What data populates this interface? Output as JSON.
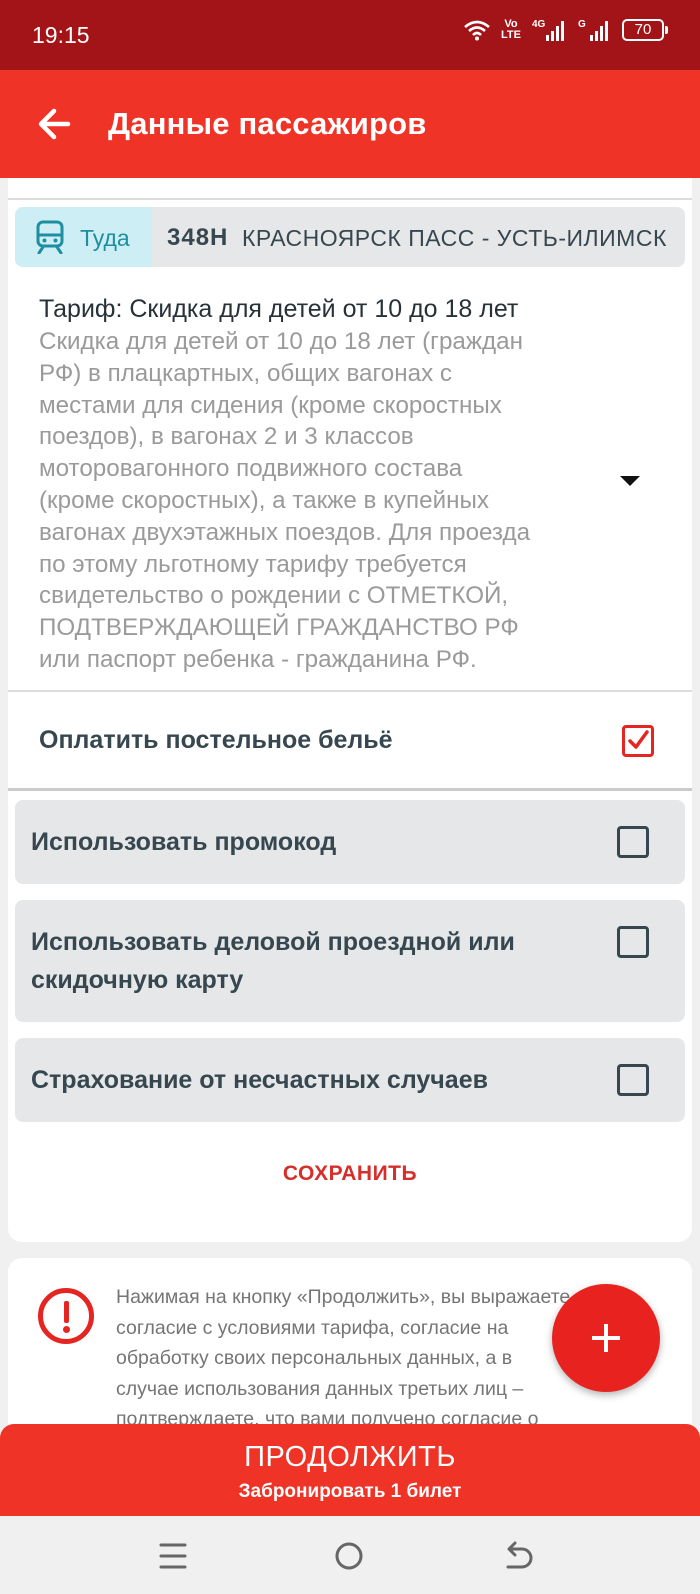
{
  "status_bar": {
    "time": "19:15",
    "volte": "Vo LTE",
    "net1": "4G",
    "net2": "G",
    "battery": "70"
  },
  "app_bar": {
    "title": "Данные пассажиров",
    "back_icon": "arrow-left-icon"
  },
  "route": {
    "direction": "Туда",
    "train_number": "348Н",
    "route_name": "КРАСНОЯРСК ПАСС - УСТЬ-ИЛИМСК",
    "icon": "train-icon",
    "accent_color": "#1d8fa0"
  },
  "tariff": {
    "title": "Тариф: Скидка для детей от 10 до 18 лет",
    "lines": [
      "Скидка для детей от 10 до 18 лет (граждан",
      "РФ) в плацкартных, общих вагонах с",
      "местами для сидения (кроме скоростных",
      "поездов), в вагонах 2 и 3 классов",
      "моторовагонного подвижного состава",
      "(кроме скоростных), а также в купейных",
      "вагонах двухэтажных поездов. Для проезда",
      "по этому льготному тарифу требуется",
      "свидетельство о рождении с ОТМЕТКОЙ,",
      "ПОДТВЕРЖДАЮЩЕЙ ГРАЖДАНСТВО РФ",
      "или паспорт ребенка - гражданина РФ."
    ]
  },
  "options": {
    "bed_linen": {
      "label": "Оплатить постельное бельё",
      "checked": true
    },
    "promo": {
      "label": "Использовать промокод",
      "checked": false
    },
    "business_card": {
      "label_line1": "Использовать деловой проездной или",
      "label_line2": "скидочную карту",
      "checked": false
    },
    "insurance": {
      "label": "Страхование от несчастных случаев",
      "checked": false
    }
  },
  "save_label": "СОХРАНИТЬ",
  "notice": {
    "icon": "exclamation-circle-icon",
    "lines": [
      "Нажимая на кнопку «Продолжить», вы выражаете",
      "согласие с условиями тарифа, согласие на",
      "обработку своих персональных данных, а в",
      "случае использования данных третьих лиц –",
      "подтверждаете, что вами получено согласие о"
    ]
  },
  "fab_icon": "plus-icon",
  "continue": {
    "label": "ПРОДОЛЖИТЬ",
    "sublabel": "Забронировать 1 билет"
  },
  "colors": {
    "status_bar": "#a31419",
    "primary": "#ef3327",
    "text_dark": "#37474f",
    "text_muted": "#9a9a9a"
  }
}
